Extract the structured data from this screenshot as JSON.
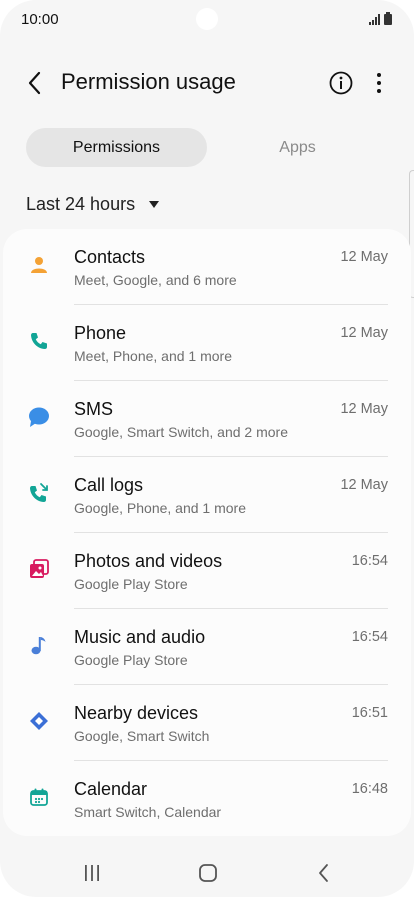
{
  "status": {
    "time": "10:00"
  },
  "header": {
    "title": "Permission usage"
  },
  "tabs": [
    {
      "label": "Permissions",
      "active": true
    },
    {
      "label": "Apps",
      "active": false
    }
  ],
  "filter": {
    "label": "Last 24 hours"
  },
  "permissions": [
    {
      "name": "Contacts",
      "apps": "Meet, Google, and 6 more",
      "when": "12 May",
      "icon": "contacts-icon",
      "color": "#f4a235"
    },
    {
      "name": "Phone",
      "apps": "Meet, Phone, and 1 more",
      "when": "12 May",
      "icon": "phone-icon",
      "color": "#12a596"
    },
    {
      "name": "SMS",
      "apps": "Google, Smart Switch, and 2 more",
      "when": "12 May",
      "icon": "sms-icon",
      "color": "#3a8ee6"
    },
    {
      "name": "Call logs",
      "apps": "Google, Phone, and 1 more",
      "when": "12 May",
      "icon": "call-logs-icon",
      "color": "#12a596"
    },
    {
      "name": "Photos and videos",
      "apps": "Google Play Store",
      "when": "16:54",
      "icon": "photos-icon",
      "color": "#d81b60"
    },
    {
      "name": "Music and audio",
      "apps": "Google Play Store",
      "when": "16:54",
      "icon": "music-icon",
      "color": "#4a7fd8"
    },
    {
      "name": "Nearby devices",
      "apps": "Google, Smart Switch",
      "when": "16:51",
      "icon": "nearby-devices-icon",
      "color": "#3b6fd6"
    },
    {
      "name": "Calendar",
      "apps": "Smart Switch, Calendar",
      "when": "16:48",
      "icon": "calendar-icon",
      "color": "#12a596"
    }
  ]
}
